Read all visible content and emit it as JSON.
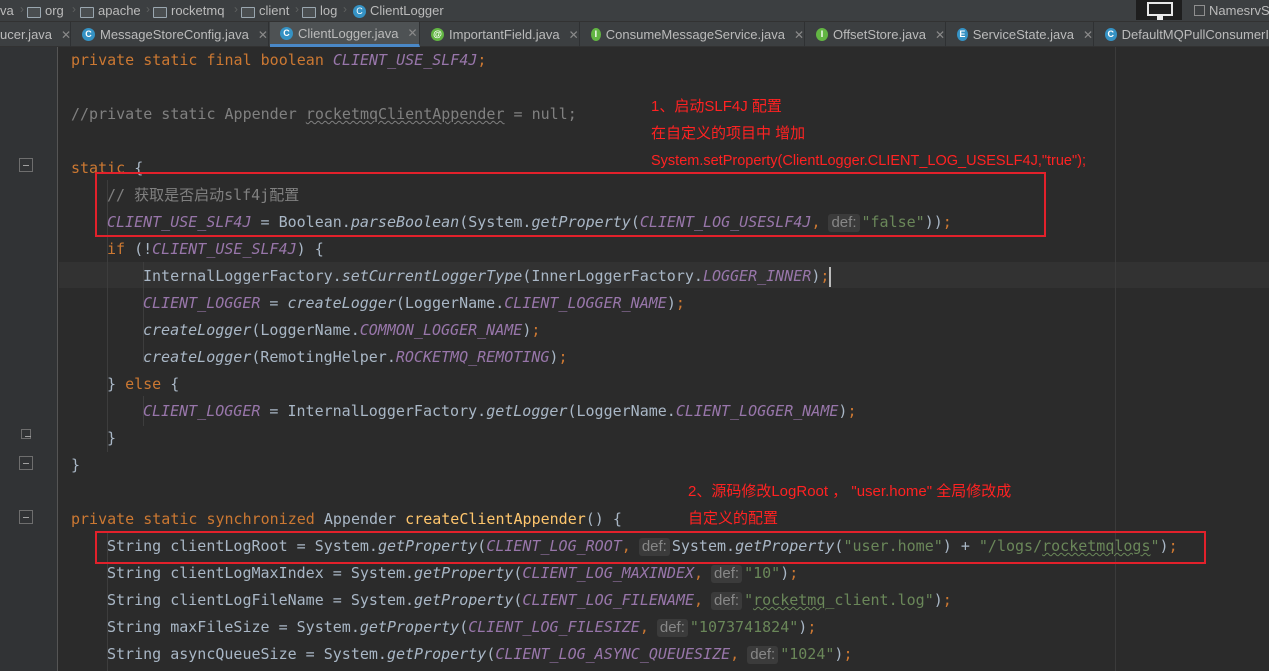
{
  "breadcrumb": {
    "items": [
      "va",
      "org",
      "apache",
      "rocketmq",
      "client",
      "log",
      "ClientLogger"
    ],
    "right_tab": "NamesrvS"
  },
  "tabs": [
    {
      "label": "ucer.java",
      "icon": "",
      "active": false
    },
    {
      "label": "MessageStoreConfig.java",
      "icon": "C",
      "active": false
    },
    {
      "label": "ClientLogger.java",
      "icon": "C",
      "active": true
    },
    {
      "label": "ImportantField.java",
      "icon": "@",
      "active": false
    },
    {
      "label": "ConsumeMessageService.java",
      "icon": "I",
      "active": false
    },
    {
      "label": "OffsetStore.java",
      "icon": "I",
      "active": false
    },
    {
      "label": "ServiceState.java",
      "icon": "E",
      "active": false
    },
    {
      "label": "DefaultMQPullConsumerI",
      "icon": "C",
      "active": false
    }
  ],
  "code": {
    "l1_kw": "private static final boolean ",
    "l1_field": "CLIENT_USE_SLF4J",
    "l1_semi": ";",
    "l2_comment_a": "//private static Appender ",
    "l2_comment_b": "rocketmqClientAppender",
    "l2_comment_c": " = null;",
    "l3_kw": "static",
    "l3_brace": " {",
    "l4_comment": "// 获取是否启动slf4j配置",
    "l5_field": "CLIENT_USE_SLF4J",
    "l5_eq": " = Boolean.",
    "l5_m1": "parseBoolean",
    "l5_p1": "(System.",
    "l5_m2": "getProperty",
    "l5_p2": "(",
    "l5_f2": "CLIENT_LOG_USESLF4J",
    "l5_comma": ",",
    "l5_hint": "def:",
    "l5_str": "\"false\"",
    "l5_end": "))",
    "l5_semi": ";",
    "l6_kw": "if",
    "l6_a": " (!",
    "l6_field": "CLIENT_USE_SLF4J",
    "l6_b": ") {",
    "l7_a": "InternalLoggerFactory.",
    "l7_m": "setCurrentLoggerType",
    "l7_b": "(InnerLoggerFactory.",
    "l7_f": "LOGGER_INNER",
    "l7_c": ")",
    "l7_semi": ";",
    "l8_f": "CLIENT_LOGGER",
    "l8_a": " = ",
    "l8_m": "createLogger",
    "l8_b": "(LoggerName.",
    "l8_f2": "CLIENT_LOGGER_NAME",
    "l8_c": ")",
    "l8_semi": ";",
    "l9_m": "createLogger",
    "l9_b": "(LoggerName.",
    "l9_f": "COMMON_LOGGER_NAME",
    "l9_c": ")",
    "l9_semi": ";",
    "l10_m": "createLogger",
    "l10_b": "(RemotingHelper.",
    "l10_f": "ROCKETMQ_REMOTING",
    "l10_c": ")",
    "l10_semi": ";",
    "l11_a": "} ",
    "l11_kw": "else",
    "l11_b": " {",
    "l12_f": "CLIENT_LOGGER",
    "l12_a": " = InternalLoggerFactory.",
    "l12_m": "getLogger",
    "l12_b": "(LoggerName.",
    "l12_f2": "CLIENT_LOGGER_NAME",
    "l12_c": ")",
    "l12_semi": ";",
    "l13": "}",
    "l14": "}",
    "l15_kw": "private static synchronized ",
    "l15_type": "Appender ",
    "l15_m": "createClientAppender",
    "l15_b": "() {",
    "l16_a": "String clientLogRoot = System.",
    "l16_m": "getProperty",
    "l16_b": "(",
    "l16_f": "CLIENT_LOG_ROOT",
    "l16_comma": ",",
    "l16_hint": "def:",
    "l16_c": "System.",
    "l16_m2": "getProperty",
    "l16_d": "(",
    "l16_s1": "\"user.home\"",
    "l16_e": ") + ",
    "l16_s2a": "\"/logs/",
    "l16_s2b": "rocketmqlogs",
    "l16_s2c": "\"",
    "l16_f2": ")",
    "l16_semi": ";",
    "l17_a": "String clientLogMaxIndex = System.",
    "l17_m": "getProperty",
    "l17_b": "(",
    "l17_f": "CLIENT_LOG_MAXINDEX",
    "l17_comma": ",",
    "l17_hint": "def:",
    "l17_s": "\"10\"",
    "l17_c": ")",
    "l17_semi": ";",
    "l18_a": "String clientLogFileName = System.",
    "l18_m": "getProperty",
    "l18_b": "(",
    "l18_f": "CLIENT_LOG_FILENAME",
    "l18_comma": ",",
    "l18_hint": "def:",
    "l18_s1": "\"",
    "l18_s2": "rocketmq",
    "l18_s3": "_client.log\"",
    "l18_c": ")",
    "l18_semi": ";",
    "l19_a": "String maxFileSize = System.",
    "l19_m": "getProperty",
    "l19_b": "(",
    "l19_f": "CLIENT_LOG_FILESIZE",
    "l19_comma": ",",
    "l19_hint": "def:",
    "l19_s": "\"1073741824\"",
    "l19_c": ")",
    "l19_semi": ";",
    "l20_a": "String asyncQueueSize = System.",
    "l20_m": "getProperty",
    "l20_b": "(",
    "l20_f": "CLIENT_LOG_ASYNC_QUEUESIZE",
    "l20_comma": ",",
    "l20_hint": "def:",
    "l20_s": "\"1024\"",
    "l20_c": ")",
    "l20_semi": ";"
  },
  "annotations": {
    "note1_line1": "1、启动SLF4J 配置",
    "note1_line2": "在自定义的项目中  增加",
    "note1_line3": "System.setProperty(ClientLogger.CLIENT_LOG_USESLF4J,\"true\");",
    "note2_line1": "2、源码修改LogRoot ，  \"user.home\"  全局修改成",
    "note2_line2": "自定义的配置"
  },
  "colors": {
    "keyword": "#cc7832",
    "field": "#9876aa",
    "method": "#ffc66d",
    "string": "#6a8759",
    "comment": "#808080",
    "annotation_red": "#e2212b"
  }
}
